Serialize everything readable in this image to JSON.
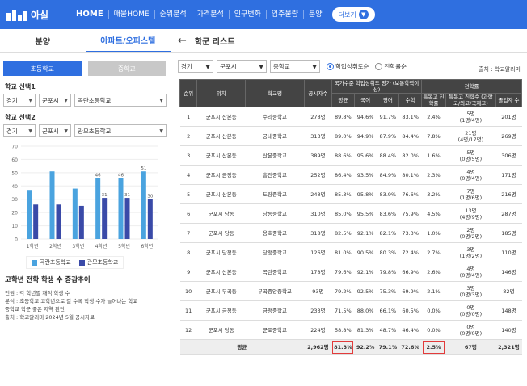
{
  "brand": {
    "name": "아실"
  },
  "nav": {
    "items": [
      "HOME",
      "매물HOME",
      "순위분석",
      "가격분석",
      "인구변화",
      "입주물량",
      "분양"
    ],
    "more": "더보기"
  },
  "left": {
    "tabs": [
      "분양",
      "아파트/오피스텔"
    ],
    "school_tabs": [
      "초등학교",
      "중학교"
    ],
    "select1": {
      "label": "학교 선택1",
      "region": "경기",
      "city": "군포시",
      "school": "곡란초등학교"
    },
    "select2": {
      "label": "학교 선택2",
      "region": "경기",
      "city": "군포시",
      "school": "관모초등학교"
    },
    "legend": [
      "곡란초등학교",
      "관모초등학교"
    ],
    "notes": {
      "title": "고학년 전학 학생 수 증감추이",
      "lines": [
        "인원 : 각 학년별 재적 학생 수",
        "분석 : 초등학교 고학년으로 갈 수록 학생 수가 늘어나는 학교",
        "중학교 학군 좋은 지역 판단",
        "출처 : 학교알리미 2024년 5월 공시자료"
      ]
    }
  },
  "chart_data": {
    "type": "bar",
    "categories": [
      "1학년",
      "2학년",
      "3학년",
      "4학년",
      "5학년",
      "6학년"
    ],
    "ylim": [
      0,
      70
    ],
    "yticks": [
      0,
      10,
      20,
      30,
      40,
      50,
      60,
      70
    ],
    "series": [
      {
        "name": "곡란초등학교",
        "values": [
          37,
          51,
          38,
          46,
          46,
          51
        ]
      },
      {
        "name": "관모초등학교",
        "values": [
          26,
          26,
          25,
          31,
          31,
          30
        ]
      }
    ],
    "data_labels": [
      "",
      "",
      "",
      "46/31",
      "46/31",
      "51/30"
    ],
    "colors": [
      "#4aa3df",
      "#3a4aa8"
    ]
  },
  "right": {
    "title": "학군 리스트",
    "filters": {
      "region": "경기",
      "city": "군포시",
      "level": "중학교",
      "radio1": "학업성취도순",
      "radio2": "전학률순",
      "source": "출처 : 학교알리미"
    },
    "headers": {
      "rank": "순위",
      "loc": "위치",
      "name": "학교명",
      "students": "공시자수",
      "group1": "국가수준 학업성취도 평가 (보통학력이상)",
      "avg": "평균",
      "kor": "국어",
      "eng": "영어",
      "math": "수학",
      "group2": "전학률",
      "spec": "특목고 진학률",
      "spec_count": "특목고 진학수 (과학고/외고/국제고)",
      "grad": "졸업자 수"
    },
    "rows": [
      [
        "1",
        "군포시 산본동",
        "수리중학교",
        "278명",
        "89.8%",
        "94.6%",
        "91.7%",
        "83.1%",
        "2.4%",
        "5명",
        "(1명/4명)",
        "201명"
      ],
      [
        "2",
        "군포시 산본동",
        "궁내중학교",
        "313명",
        "89.0%",
        "94.9%",
        "87.9%",
        "84.4%",
        "7.8%",
        "21명",
        "(4명/17명)",
        "269명"
      ],
      [
        "3",
        "군포시 산본동",
        "산본중학교",
        "389명",
        "88.6%",
        "95.6%",
        "88.4%",
        "82.0%",
        "1.6%",
        "5명",
        "(0명/5명)",
        "306명"
      ],
      [
        "4",
        "군포시 금정동",
        "흥진중학교",
        "252명",
        "86.4%",
        "93.5%",
        "84.9%",
        "80.1%",
        "2.3%",
        "4명",
        "(0명/4명)",
        "171명"
      ],
      [
        "5",
        "군포시 산본동",
        "도장중학교",
        "248명",
        "85.3%",
        "95.8%",
        "83.9%",
        "76.6%",
        "3.2%",
        "7명",
        "(1명/6명)",
        "216명"
      ],
      [
        "6",
        "군포시 당동",
        "당동중학교",
        "310명",
        "85.0%",
        "95.5%",
        "83.6%",
        "75.9%",
        "4.5%",
        "13명",
        "(4명/9명)",
        "287명"
      ],
      [
        "7",
        "군포시 당동",
        "용호중학교",
        "318명",
        "82.5%",
        "92.1%",
        "82.1%",
        "73.3%",
        "1.0%",
        "2명",
        "(0명/2명)",
        "185명"
      ],
      [
        "8",
        "군포시 당정동",
        "당정중학교",
        "126명",
        "81.0%",
        "90.5%",
        "80.3%",
        "72.4%",
        "2.7%",
        "3명",
        "(1명/2명)",
        "110명"
      ],
      [
        "9",
        "군포시 산본동",
        "곡란중학교",
        "178명",
        "79.6%",
        "92.1%",
        "79.8%",
        "66.9%",
        "2.6%",
        "4명",
        "(0명/4명)",
        "146명"
      ],
      [
        "10",
        "군포시 부곡동",
        "부곡중앙중학교",
        "93명",
        "79.2%",
        "92.5%",
        "75.3%",
        "69.9%",
        "2.1%",
        "3명",
        "(0명/3명)",
        "82명"
      ],
      [
        "11",
        "군포시 금정동",
        "금정중학교",
        "233명",
        "71.5%",
        "88.0%",
        "66.1%",
        "60.5%",
        "0.0%",
        "0명",
        "(0명/0명)",
        "148명"
      ],
      [
        "12",
        "군포시 당동",
        "군포중학교",
        "224명",
        "58.8%",
        "81.3%",
        "48.7%",
        "46.4%",
        "0.0%",
        "0명",
        "(0명/0명)",
        "140명"
      ]
    ],
    "avg_row": [
      "평균",
      "2,962명",
      "81.3%",
      "92.2%",
      "79.1%",
      "72.6%",
      "2.5%",
      "67명",
      "2,321명"
    ]
  }
}
